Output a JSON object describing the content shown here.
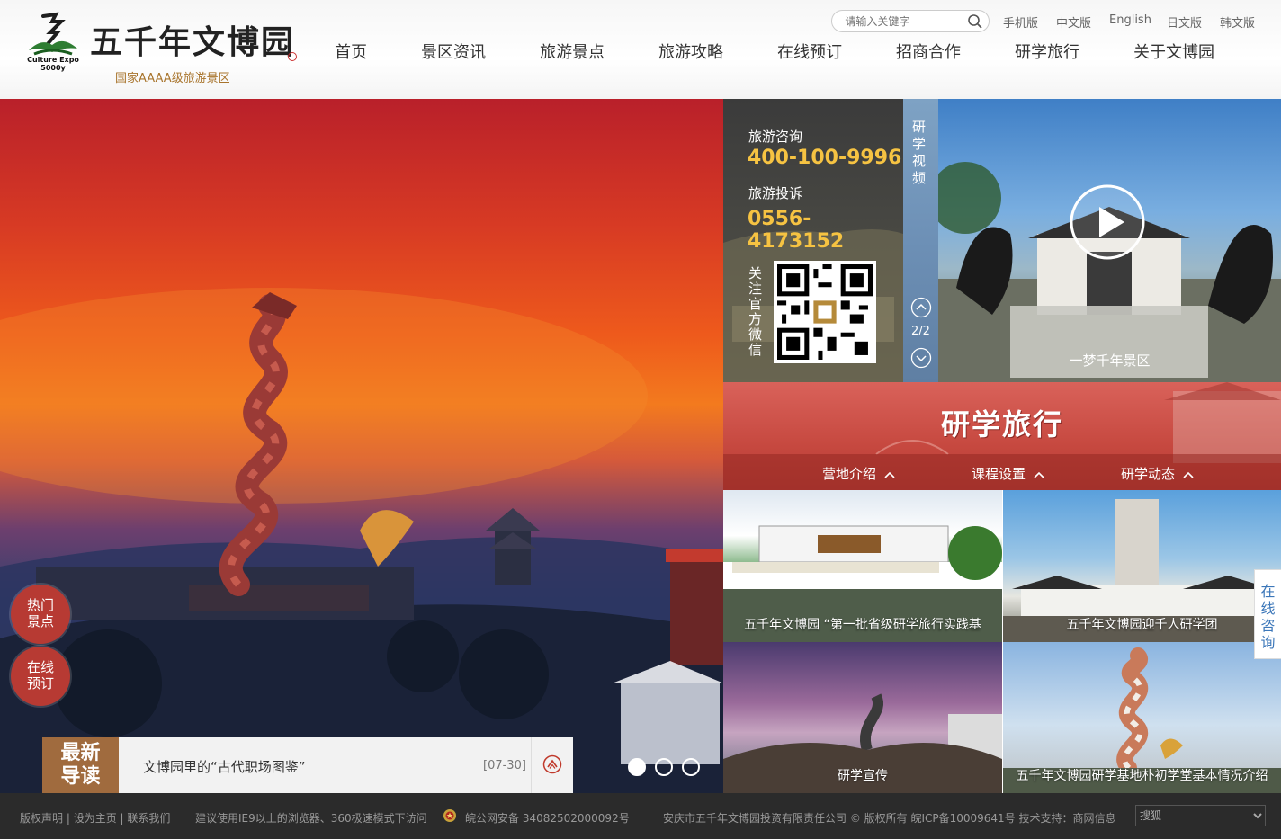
{
  "header": {
    "logo_text": "五千年文博园",
    "logo_en_line1": "Culture Expo",
    "logo_en_line2": "5000y",
    "logo_sub": "国家AAAA级旅游景区",
    "search_placeholder": "-请输入关键字-",
    "languages": [
      "手机版",
      "中文版",
      "English",
      "日文版",
      "韩文版"
    ],
    "nav": [
      "首页",
      "景区资讯",
      "旅游景点",
      "旅游攻略",
      "在线预订",
      "招商合作",
      "研学旅行",
      "关于文博园"
    ]
  },
  "hero": {
    "float_buttons": [
      {
        "line1": "热门",
        "line2": "景点"
      },
      {
        "line1": "在线",
        "line2": "预订"
      }
    ],
    "news": {
      "badge_line1": "最新",
      "badge_line2": "导读",
      "title": "文博园里的“古代职场图鉴”",
      "date": "[07-30]"
    },
    "slides": 3,
    "active_slide": 0
  },
  "contact": {
    "consult_label": "旅游咨询",
    "consult_phone": "400-100-9996",
    "complaint_label": "旅游投诉",
    "complaint_phone": "0556-4173152",
    "follow_label": "关注官方微信"
  },
  "video": {
    "strip_label": "研学视频",
    "page": "2/2",
    "caption": "一梦千年景区"
  },
  "study": {
    "title": "研学旅行",
    "tabs": [
      "营地介绍",
      "课程设置",
      "研学动态"
    ],
    "items": [
      "五千年文博园 “第一批省级研学旅行实践基",
      "五千年文博园迎千人研学团",
      "研学宣传",
      "五千年文博园研学基地朴初学堂基本情况介绍"
    ]
  },
  "side_consult": "在线咨询",
  "footer": {
    "links": [
      "版权声明",
      "设为主页",
      "联系我们"
    ],
    "browser_tip": "建议使用IE9以上的浏览器、360极速模式下访问",
    "police": "皖公网安备 34082502000092号",
    "copyright": "安庆市五千年文博园投资有限责任公司 © 版权所有 皖ICP备10009641号 技术支持：商网信息",
    "select_value": "搜狐"
  }
}
